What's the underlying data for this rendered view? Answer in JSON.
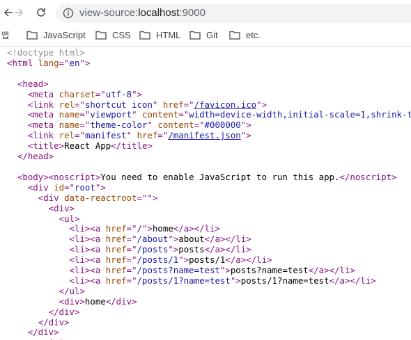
{
  "browser": {
    "url_prefix": "view-source:",
    "url_host": "localhost",
    "url_port": ":9000"
  },
  "bookmarks": {
    "apps_label": "앱",
    "folders": [
      "JavaScript",
      "CSS",
      "HTML",
      "Git",
      "etc."
    ]
  },
  "source_lines": [
    "<!doctype html>",
    "<html lang=\"en\">",
    "",
    "  <head>",
    "    <meta charset=\"utf-8\">",
    "    <link rel=\"shortcut icon\" href=\"/favicon.ico\">",
    "    <meta name=\"viewport\" content=\"width=device-width,initial-scale=1,shrink-to-fit=no\">",
    "    <meta name=\"theme-color\" content=\"#000000\">",
    "    <link rel=\"manifest\" href=\"/manifest.json\">",
    "    <title>React App</title>",
    "  </head>",
    "",
    "  <body><noscript>You need to enable JavaScript to run this app.</noscript>",
    "    <div id=\"root\">",
    "      <div data-reactroot=\"\">",
    "        <div>",
    "          <ul>",
    "            <li><a href=\"/\">home</a></li>",
    "            <li><a href=\"/about\">about</a></li>",
    "            <li><a href=\"/posts\">posts</a></li>",
    "            <li><a href=\"/posts/1\">posts/1</a></li>",
    "            <li><a href=\"/posts?name=test\">posts?name=test</a></li>",
    "            <li><a href=\"/posts/1?name=test\">posts/1?name=test</a></li>",
    "          </ul>",
    "          <div>home</div>",
    "        </div>",
    "      </div>",
    "    </div>",
    "    <script>"
  ],
  "colors": {
    "tag": "#881280",
    "attribute": "#994500",
    "value": "#1a1aa6",
    "comment": "#8e8e8e"
  }
}
